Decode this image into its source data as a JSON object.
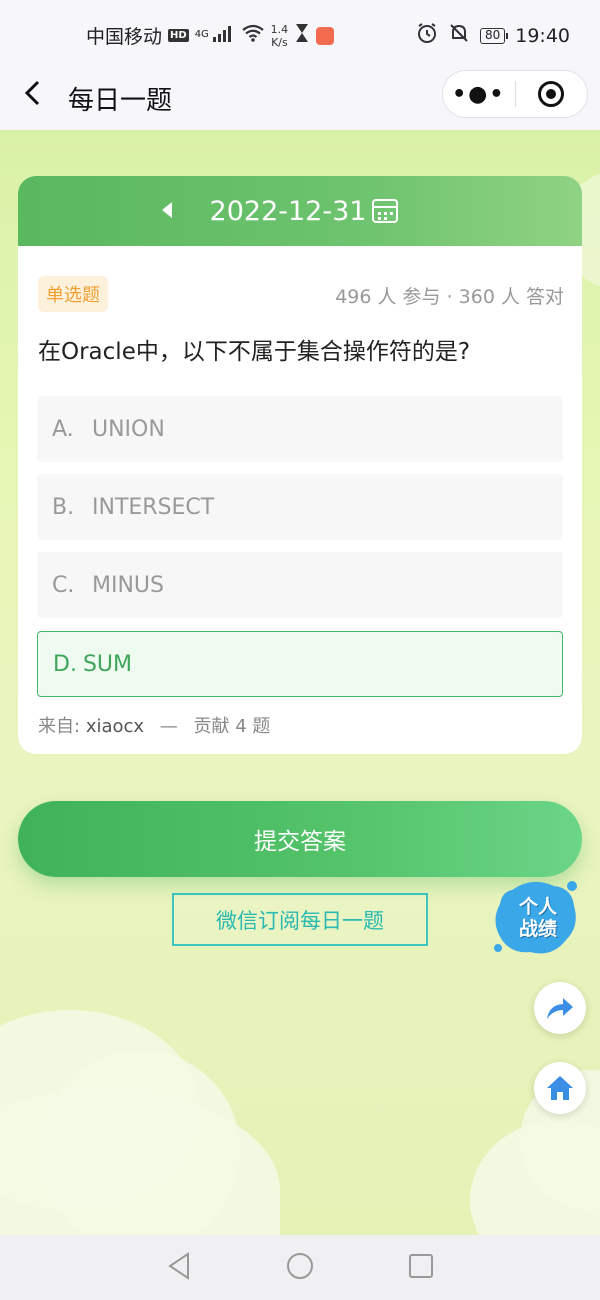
{
  "status_bar": {
    "carrier": "中国移动",
    "hd": "HD",
    "network": "4G",
    "speed_value": "1.4",
    "speed_unit": "K/s",
    "battery": "80",
    "time": "19:40"
  },
  "nav": {
    "title": "每日一题"
  },
  "card": {
    "date": "2022-12-31",
    "question_type": "单选题",
    "stats": "496 人 参与 · 360 人 答对",
    "question": "在Oracle中，以下不属于集合操作符的是?",
    "options": [
      {
        "letter": "A.",
        "text": "UNION"
      },
      {
        "letter": "B.",
        "text": "INTERSECT"
      },
      {
        "letter": "C.",
        "text": "MINUS"
      },
      {
        "letter": "D.",
        "text": "SUM"
      }
    ],
    "from_label": "来自:",
    "from_name": "xiaocx",
    "from_dash": "—",
    "from_contrib": "贡献 4 题"
  },
  "actions": {
    "submit": "提交答案",
    "subscribe": "微信订阅每日一题",
    "personal_stats_line1": "个人",
    "personal_stats_line2": "战绩"
  },
  "colors": {
    "accent_green": "#4cb466",
    "type_orange": "#f0a030",
    "subscribe_teal": "#29b9b0"
  }
}
